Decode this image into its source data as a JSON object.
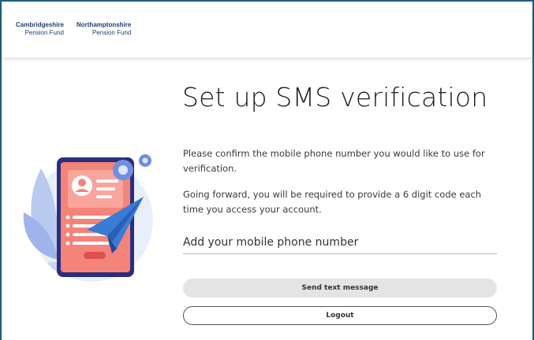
{
  "header": {
    "logo_left": {
      "line1": "Cambridgeshire",
      "line2": "Pension Fund"
    },
    "logo_right": {
      "line1": "Northamptonshire",
      "line2": "Pension Fund"
    }
  },
  "main": {
    "title": "Set up SMS verification",
    "paragraph1": "Please confirm the mobile phone number you would like to use for verification.",
    "paragraph2": "Going forward, you will be required to provide a 6 digit code each time you access your account.",
    "phone_input": {
      "placeholder": "Add your mobile phone number",
      "value": ""
    },
    "send_button_label": "Send text message",
    "logout_button_label": "Logout"
  },
  "illustration": {
    "icon": "phone-with-paper-plane-illustration"
  },
  "colors": {
    "frame_border": "#1f5d7a",
    "logo_text": "#1f3e78",
    "send_button_bg": "#e4e4e6",
    "phone_body": "#2b2f7a",
    "phone_screen": "#f4837a",
    "plane": "#3a7bd5"
  }
}
